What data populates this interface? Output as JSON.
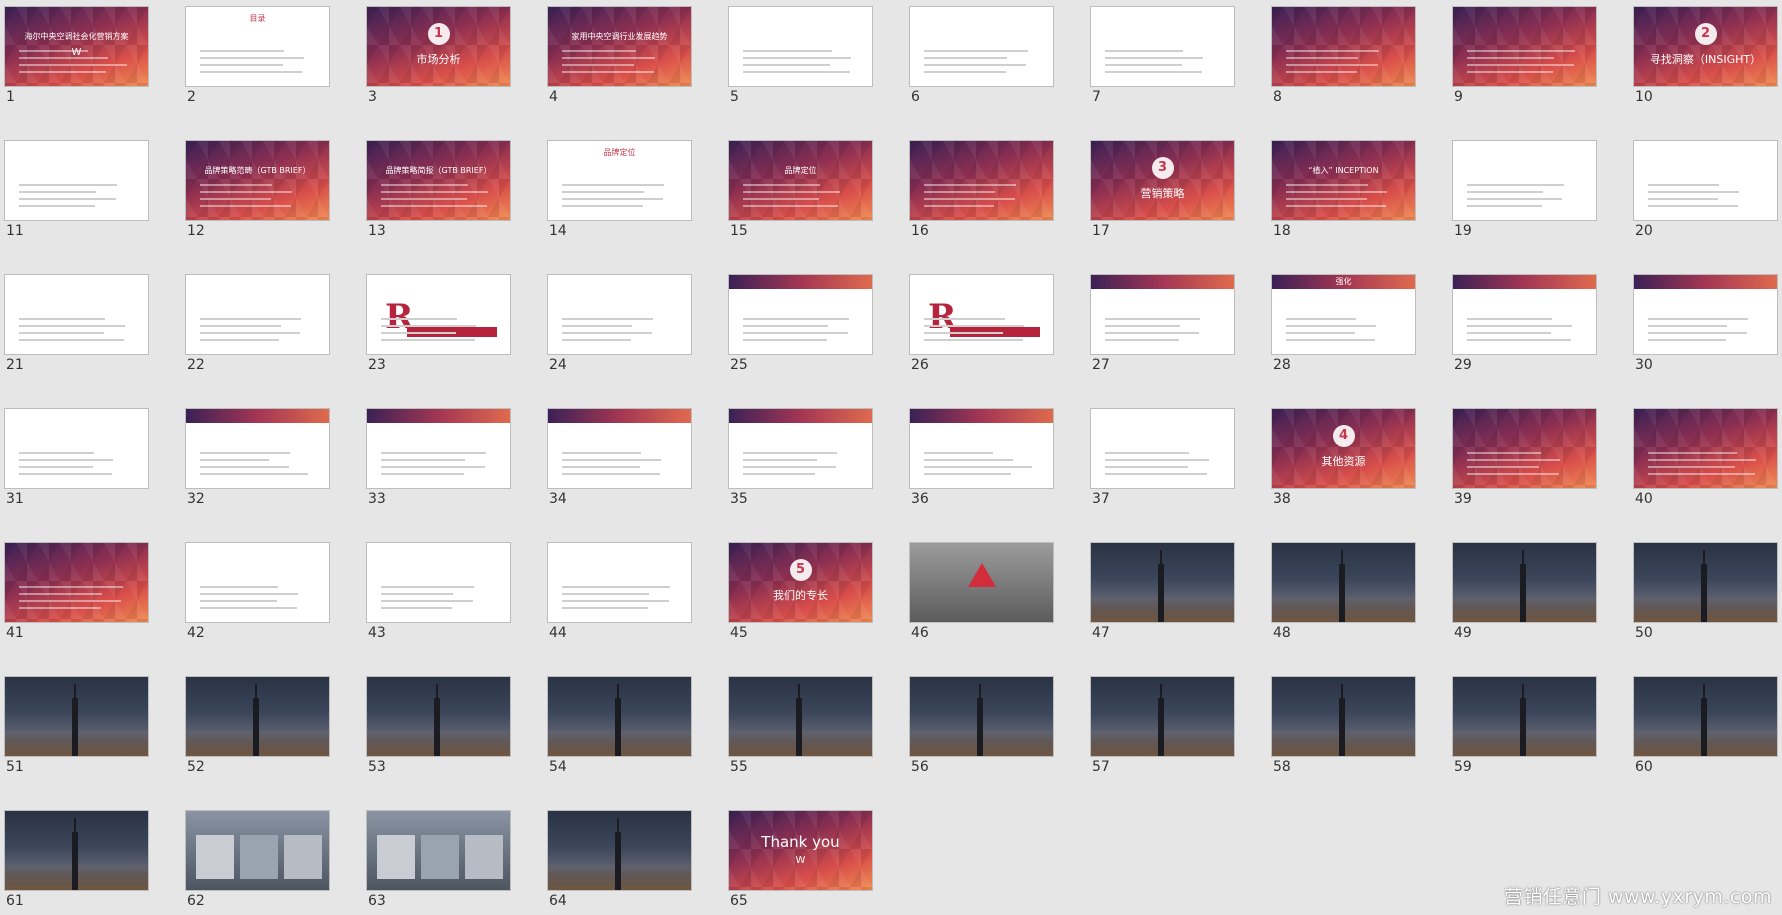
{
  "watermark": "营销任意门 www.yxrym.com",
  "slides": [
    {
      "num": "1",
      "theme": "grad",
      "title": "海尔中央空调社会化营销方案",
      "sub": "W"
    },
    {
      "num": "2",
      "theme": "white",
      "title": "目录"
    },
    {
      "num": "3",
      "theme": "grad",
      "badge": "1",
      "title": "市场分析"
    },
    {
      "num": "4",
      "theme": "grad",
      "title": "家用中央空调行业发展趋势"
    },
    {
      "num": "5",
      "theme": "white"
    },
    {
      "num": "6",
      "theme": "white"
    },
    {
      "num": "7",
      "theme": "white"
    },
    {
      "num": "8",
      "theme": "grad"
    },
    {
      "num": "9",
      "theme": "grad"
    },
    {
      "num": "10",
      "theme": "grad",
      "badge": "2",
      "title": "寻找洞察（INSIGHT）"
    },
    {
      "num": "11",
      "theme": "white"
    },
    {
      "num": "12",
      "theme": "grad",
      "title": "品牌策略范畴（GTB BRIEF）"
    },
    {
      "num": "13",
      "theme": "grad",
      "title": "品牌策略简报（GTB BRIEF）"
    },
    {
      "num": "14",
      "theme": "white",
      "title": "品牌定位"
    },
    {
      "num": "15",
      "theme": "grad",
      "title": "品牌定位"
    },
    {
      "num": "16",
      "theme": "grad"
    },
    {
      "num": "17",
      "theme": "grad",
      "badge": "3",
      "title": "营销策略"
    },
    {
      "num": "18",
      "theme": "grad",
      "title": "“植入” INCEPTION"
    },
    {
      "num": "19",
      "theme": "white"
    },
    {
      "num": "20",
      "theme": "white"
    },
    {
      "num": "21",
      "theme": "white"
    },
    {
      "num": "22",
      "theme": "white"
    },
    {
      "num": "23",
      "theme": "white",
      "R": "R"
    },
    {
      "num": "24",
      "theme": "white"
    },
    {
      "num": "25",
      "theme": "whitebanner"
    },
    {
      "num": "26",
      "theme": "white",
      "R": "R"
    },
    {
      "num": "27",
      "theme": "whitebanner"
    },
    {
      "num": "28",
      "theme": "whitebanner",
      "title": "强化"
    },
    {
      "num": "29",
      "theme": "whitebanner"
    },
    {
      "num": "30",
      "theme": "whitebanner"
    },
    {
      "num": "31",
      "theme": "white"
    },
    {
      "num": "32",
      "theme": "whitebanner"
    },
    {
      "num": "33",
      "theme": "whitebanner"
    },
    {
      "num": "34",
      "theme": "whitebanner"
    },
    {
      "num": "35",
      "theme": "whitebanner"
    },
    {
      "num": "36",
      "theme": "whitebanner"
    },
    {
      "num": "37",
      "theme": "white"
    },
    {
      "num": "38",
      "theme": "grad",
      "badge": "4",
      "title": "其他资源"
    },
    {
      "num": "39",
      "theme": "grad"
    },
    {
      "num": "40",
      "theme": "grad"
    },
    {
      "num": "41",
      "theme": "grad"
    },
    {
      "num": "42",
      "theme": "white"
    },
    {
      "num": "43",
      "theme": "white"
    },
    {
      "num": "44",
      "theme": "white"
    },
    {
      "num": "45",
      "theme": "grad",
      "badge": "5",
      "title": "我们的专长"
    },
    {
      "num": "46",
      "theme": "gray"
    },
    {
      "num": "47",
      "theme": "city"
    },
    {
      "num": "48",
      "theme": "city"
    },
    {
      "num": "49",
      "theme": "city"
    },
    {
      "num": "50",
      "theme": "city"
    },
    {
      "num": "51",
      "theme": "city"
    },
    {
      "num": "52",
      "theme": "city"
    },
    {
      "num": "53",
      "theme": "city"
    },
    {
      "num": "54",
      "theme": "city"
    },
    {
      "num": "55",
      "theme": "city"
    },
    {
      "num": "56",
      "theme": "city"
    },
    {
      "num": "57",
      "theme": "city"
    },
    {
      "num": "58",
      "theme": "city"
    },
    {
      "num": "59",
      "theme": "city"
    },
    {
      "num": "60",
      "theme": "city"
    },
    {
      "num": "61",
      "theme": "city"
    },
    {
      "num": "62",
      "theme": "photo"
    },
    {
      "num": "63",
      "theme": "photo"
    },
    {
      "num": "64",
      "theme": "city"
    },
    {
      "num": "65",
      "theme": "grad",
      "title": "Thank you",
      "sub": "W"
    }
  ]
}
